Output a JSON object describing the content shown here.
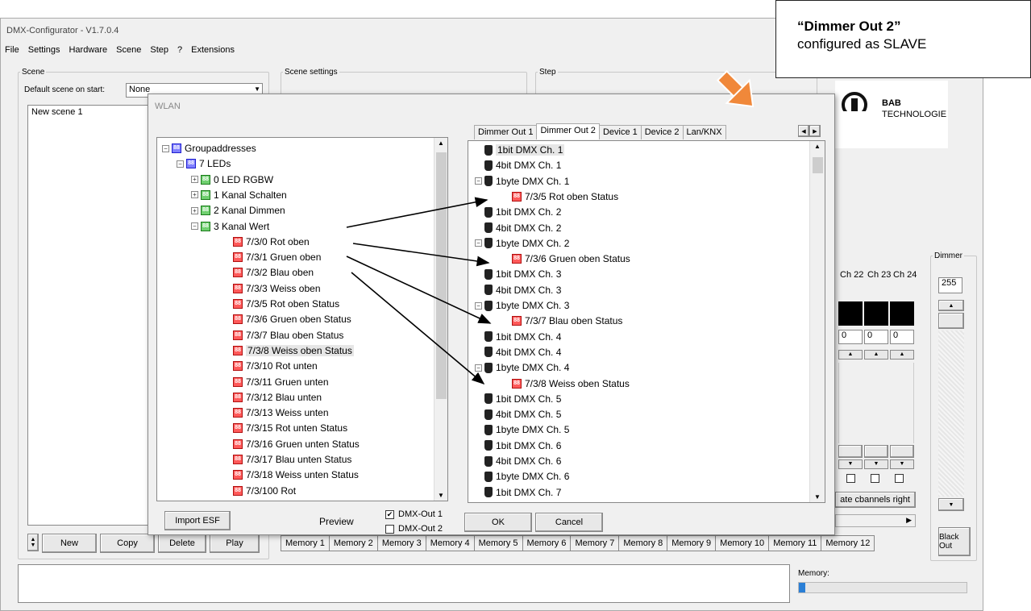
{
  "app": {
    "title": "DMX-Configurator - V1.7.0.4",
    "menu": [
      "File",
      "Settings",
      "Hardware",
      "Scene",
      "Step",
      "?",
      "Extensions"
    ]
  },
  "scene_panel": {
    "legend": "Scene",
    "default_label": "Default scene on start:",
    "default_value": "None",
    "items": [
      "New scene 1"
    ],
    "buttons": {
      "new": "New",
      "copy": "Copy",
      "delete": "Delete",
      "play": "Play"
    }
  },
  "scene_settings": {
    "legend": "Scene settings"
  },
  "step_panel": {
    "legend": "Step"
  },
  "logo": {
    "line1": "BAB",
    "line2": "TECHNOLOGIE"
  },
  "channels": {
    "headers": [
      "Ch 22",
      "Ch 23",
      "Ch 24"
    ],
    "values": [
      "0",
      "0",
      "0"
    ],
    "rotate_label": "ate cbannels right"
  },
  "dimmer": {
    "legend": "Dimmer",
    "value": "255",
    "blackout": "Black Out"
  },
  "memory": {
    "tabs": [
      "Memory 1",
      "Memory 2",
      "Memory 3",
      "Memory 4",
      "Memory 5",
      "Memory 6",
      "Memory 7",
      "Memory 8",
      "Memory 9",
      "Memory 10",
      "Memory 11",
      "Memory 12"
    ],
    "label": "Memory:",
    "progress": 0.04
  },
  "dialog": {
    "title": "WLAN",
    "tabs": [
      "Dimmer Out 1",
      "Dimmer Out 2",
      "Device 1",
      "Device 2",
      "Lan/KNX"
    ],
    "selected_tab": "Dimmer Out 2",
    "left_tree": [
      {
        "label": "Groupaddresses",
        "icon": "blue",
        "exp": "−"
      },
      {
        "label": "7 LEDs",
        "icon": "blue",
        "exp": "−"
      },
      {
        "label": "0 LED RGBW",
        "icon": "green",
        "exp": "+"
      },
      {
        "label": "1 Kanal Schalten",
        "icon": "green",
        "exp": "+"
      },
      {
        "label": "2 Kanal Dimmen",
        "icon": "green",
        "exp": "+"
      },
      {
        "label": "3 Kanal Wert",
        "icon": "green",
        "exp": "−"
      },
      {
        "label": "7/3/0 Rot oben",
        "icon": "red"
      },
      {
        "label": "7/3/1 Gruen oben",
        "icon": "red"
      },
      {
        "label": "7/3/2 Blau oben",
        "icon": "red"
      },
      {
        "label": "7/3/3 Weiss oben",
        "icon": "red"
      },
      {
        "label": "7/3/5 Rot oben Status",
        "icon": "red"
      },
      {
        "label": "7/3/6 Gruen oben Status",
        "icon": "red"
      },
      {
        "label": "7/3/7 Blau oben Status",
        "icon": "red"
      },
      {
        "label": "7/3/8 Weiss oben Status",
        "icon": "red",
        "selected": true
      },
      {
        "label": "7/3/10 Rot unten",
        "icon": "red"
      },
      {
        "label": "7/3/11 Gruen unten",
        "icon": "red"
      },
      {
        "label": "7/3/12 Blau unten",
        "icon": "red"
      },
      {
        "label": "7/3/13 Weiss unten",
        "icon": "red"
      },
      {
        "label": "7/3/15 Rot unten Status",
        "icon": "red"
      },
      {
        "label": "7/3/16 Gruen unten Status",
        "icon": "red"
      },
      {
        "label": "7/3/17 Blau unten Status",
        "icon": "red"
      },
      {
        "label": "7/3/18 Weiss unten Status",
        "icon": "red"
      },
      {
        "label": "7/3/100 Rot",
        "icon": "red"
      }
    ],
    "right_tree": [
      {
        "label": "1bit DMX Ch. 1",
        "icon": "dmx",
        "highlight": true
      },
      {
        "label": "4bit DMX Ch. 1",
        "icon": "dmx"
      },
      {
        "label": "1byte DMX Ch. 1",
        "icon": "dmx",
        "exp": "−"
      },
      {
        "label": "7/3/5 Rot oben Status",
        "icon": "red",
        "child": true
      },
      {
        "label": "1bit DMX Ch. 2",
        "icon": "dmx"
      },
      {
        "label": "4bit DMX Ch. 2",
        "icon": "dmx"
      },
      {
        "label": "1byte DMX Ch. 2",
        "icon": "dmx",
        "exp": "−"
      },
      {
        "label": "7/3/6 Gruen oben Status",
        "icon": "red",
        "child": true
      },
      {
        "label": "1bit DMX Ch. 3",
        "icon": "dmx"
      },
      {
        "label": "4bit DMX Ch. 3",
        "icon": "dmx"
      },
      {
        "label": "1byte DMX Ch. 3",
        "icon": "dmx",
        "exp": "−"
      },
      {
        "label": "7/3/7 Blau oben Status",
        "icon": "red",
        "child": true
      },
      {
        "label": "1bit DMX Ch. 4",
        "icon": "dmx"
      },
      {
        "label": "4bit DMX Ch. 4",
        "icon": "dmx"
      },
      {
        "label": "1byte DMX Ch. 4",
        "icon": "dmx",
        "exp": "−"
      },
      {
        "label": "7/3/8 Weiss oben Status",
        "icon": "red",
        "child": true
      },
      {
        "label": "1bit DMX Ch. 5",
        "icon": "dmx"
      },
      {
        "label": "4bit DMX Ch. 5",
        "icon": "dmx"
      },
      {
        "label": "1byte DMX Ch. 5",
        "icon": "dmx"
      },
      {
        "label": "1bit DMX Ch. 6",
        "icon": "dmx"
      },
      {
        "label": "4bit DMX Ch. 6",
        "icon": "dmx"
      },
      {
        "label": "1byte DMX Ch. 6",
        "icon": "dmx"
      },
      {
        "label": "1bit DMX Ch. 7",
        "icon": "dmx"
      }
    ],
    "import_label": "Import ESF",
    "preview_label": "Preview",
    "out1_label": "DMX-Out 1",
    "out1_checked": true,
    "out2_label": "DMX-Out 2",
    "out2_checked": false,
    "ok_label": "OK",
    "cancel_label": "Cancel"
  },
  "callout": {
    "heading": "“Dimmer Out 2”",
    "subtext": "configured as SLAVE"
  },
  "colors": {
    "accent_orange": "#f0883a",
    "selection": "#e8e8e8"
  }
}
